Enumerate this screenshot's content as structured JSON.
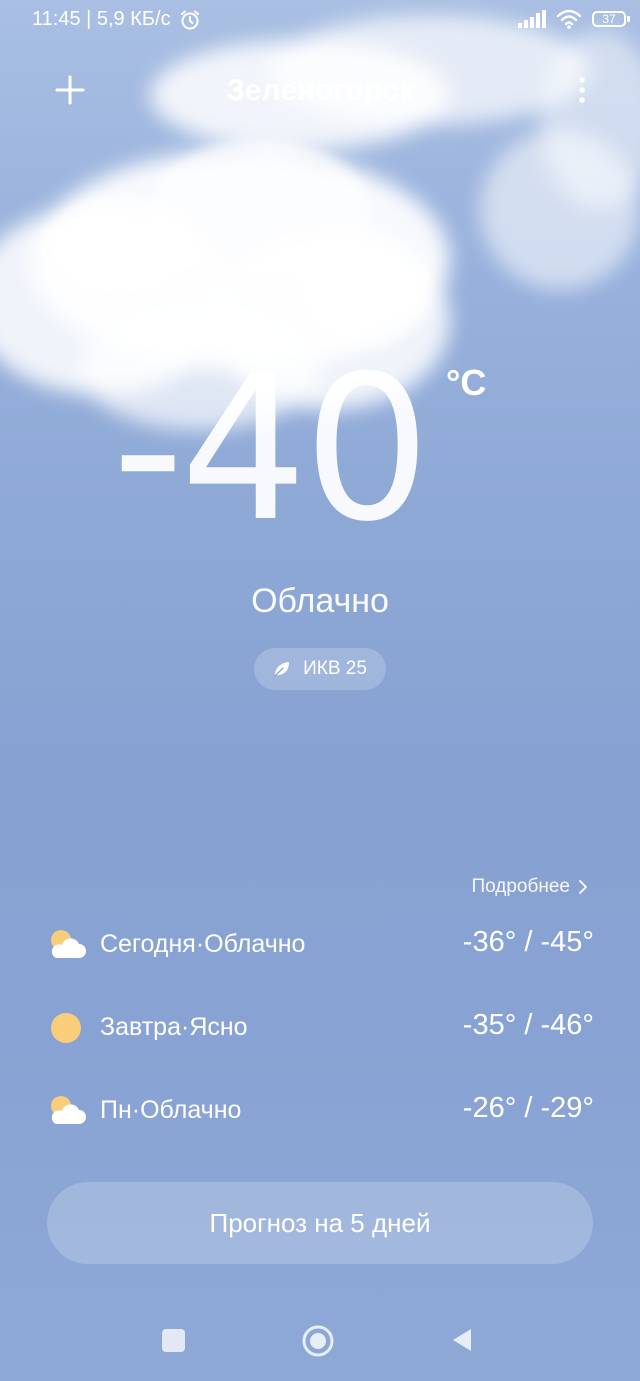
{
  "status_bar": {
    "time_speed": "11:45 | 5,9 КБ/с",
    "battery": "37"
  },
  "header": {
    "city": "Зеленогорск"
  },
  "current": {
    "temperature": "-40",
    "unit": "°C",
    "condition": "Облачно",
    "aqi": "ИКВ 25"
  },
  "forecast": {
    "more_label": "Подробнее",
    "days": [
      {
        "icon": "partly-cloudy-icon",
        "description": "Сегодня·Облачно",
        "temps": "-36° / -45°"
      },
      {
        "icon": "sun-icon",
        "description": "Завтра·Ясно",
        "temps": "-35° / -46°"
      },
      {
        "icon": "partly-cloudy-icon",
        "description": "Пн·Облачно",
        "temps": "-26° / -29°"
      }
    ]
  },
  "five_day_button": "Прогноз на 5 дней",
  "colors": {
    "sky_top": "#a9bfe3",
    "sky_bottom": "#8ea9d6",
    "sun": "#f9cd7a"
  }
}
